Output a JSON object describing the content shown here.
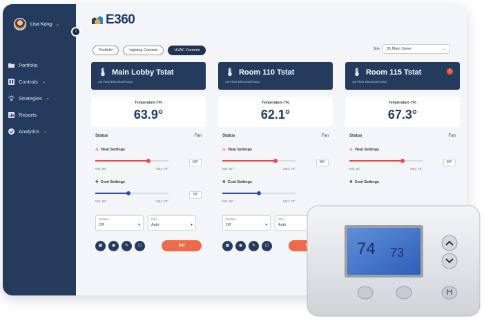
{
  "sidebar": {
    "user_name": "Lisa Kang",
    "items": [
      {
        "label": "Portfolio",
        "icon": "folder-icon",
        "chevron": false
      },
      {
        "label": "Controls",
        "icon": "controls-icon",
        "chevron": true
      },
      {
        "label": "Strategies",
        "icon": "lightbulb-icon",
        "chevron": true
      },
      {
        "label": "Reports",
        "icon": "bar-chart-icon",
        "chevron": false
      },
      {
        "label": "Analytics",
        "icon": "check-circle-icon",
        "chevron": true
      }
    ]
  },
  "brand": {
    "name": "E360",
    "color": "#1c3a69"
  },
  "tabs": [
    {
      "label": "Portfolio",
      "active": false
    },
    {
      "label": "Lighting Controls",
      "active": false
    },
    {
      "label": "HVAC Controls",
      "active": true
    }
  ],
  "site": {
    "label": "Site",
    "value": "55 Main Street"
  },
  "cards": [
    {
      "title": "Main Lobby Tstat",
      "subtitle": "1st Floor Electrical Room",
      "alert": false,
      "temp_label": "Temperature (°F)",
      "temperature": "63.9°",
      "status_label": "Status",
      "status_value": "Fan",
      "heat_label": "Heat Settings",
      "heat_value": "64°",
      "heat_level": 0.73,
      "heat_min": "Min: 62°",
      "heat_max": "Max: 78°",
      "cool_label": "Cool Settings",
      "cool_value": "74°",
      "cool_level": 0.45,
      "cool_min": "Min: 68°",
      "cool_max": "Max: 78°",
      "system_label": "System",
      "system_value": "Off",
      "fan_label": "Fan",
      "fan_value": "Auto",
      "set_label": "Set"
    },
    {
      "title": "Room 110 Tstat",
      "subtitle": "1st Floor Electrical Room",
      "alert": false,
      "temp_label": "Temperature (°F)",
      "temperature": "62.1°",
      "status_label": "Status",
      "status_value": "Fan",
      "heat_label": "Heat Settings",
      "heat_value": "64°",
      "heat_level": 0.73,
      "heat_min": "Min: 62°",
      "heat_max": "Max: 78°",
      "cool_label": "Cool Settings",
      "cool_value": "",
      "cool_level": 0.5,
      "cool_min": "Min: 68°",
      "cool_max": "Max: 78°",
      "system_label": "System",
      "system_value": "Off",
      "fan_label": "Fan",
      "fan_value": "Auto",
      "set_label": "Set"
    },
    {
      "title": "Room 115 Tstat",
      "subtitle": "1st Floor Electrical Room",
      "alert": true,
      "alert_text": "!",
      "temp_label": "Temperature (°F)",
      "temperature": "67.3°",
      "status_label": "Status",
      "status_value": "Fan",
      "heat_label": "Heat Settings",
      "heat_value": "64°",
      "heat_level": 0.73,
      "heat_min": "Min: 62°",
      "heat_max": "Max: 78°",
      "cool_label": "Cool Settings"
    }
  ],
  "colors": {
    "navy": "#243b5e",
    "heat": "#e8484b",
    "cool": "#3448a8",
    "set": "#ef6a4a"
  },
  "device": {
    "display_temp": "74",
    "display_setpoint": "73"
  }
}
